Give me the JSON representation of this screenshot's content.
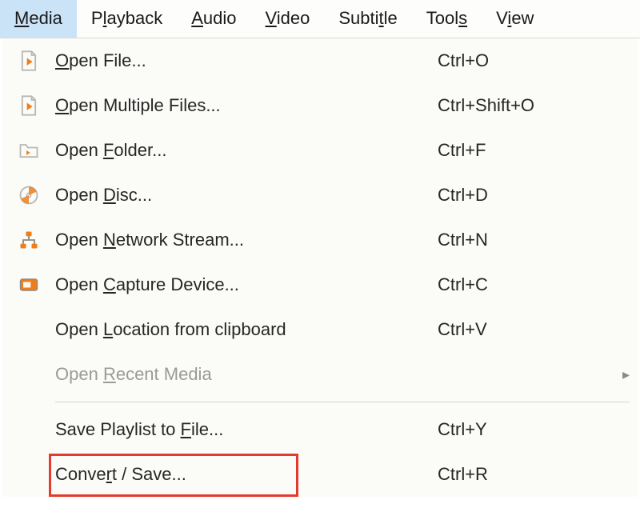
{
  "menubar": {
    "items": [
      {
        "pre": "",
        "u": "M",
        "post": "edia",
        "active": true
      },
      {
        "pre": "P",
        "u": "l",
        "post": "ayback",
        "active": false
      },
      {
        "pre": "",
        "u": "A",
        "post": "udio",
        "active": false
      },
      {
        "pre": "",
        "u": "V",
        "post": "ideo",
        "active": false
      },
      {
        "pre": "Subti",
        "u": "t",
        "post": "le",
        "active": false
      },
      {
        "pre": "Tool",
        "u": "s",
        "post": "",
        "active": false
      },
      {
        "pre": "V",
        "u": "i",
        "post": "ew",
        "active": false
      }
    ]
  },
  "menu": {
    "items": [
      {
        "icon": "file-play",
        "pre": "",
        "u": "O",
        "post": "pen File...",
        "shortcut": "Ctrl+O",
        "disabled": false,
        "submenu": false
      },
      {
        "icon": "file-play",
        "pre": "",
        "u": "O",
        "post": "pen Multiple Files...",
        "shortcut": "Ctrl+Shift+O",
        "disabled": false,
        "submenu": false
      },
      {
        "icon": "folder",
        "pre": "Open ",
        "u": "F",
        "post": "older...",
        "shortcut": "Ctrl+F",
        "disabled": false,
        "submenu": false
      },
      {
        "icon": "disc",
        "pre": "Open ",
        "u": "D",
        "post": "isc...",
        "shortcut": "Ctrl+D",
        "disabled": false,
        "submenu": false
      },
      {
        "icon": "network",
        "pre": "Open ",
        "u": "N",
        "post": "etwork Stream...",
        "shortcut": "Ctrl+N",
        "disabled": false,
        "submenu": false
      },
      {
        "icon": "capture",
        "pre": "Open ",
        "u": "C",
        "post": "apture Device...",
        "shortcut": "Ctrl+C",
        "disabled": false,
        "submenu": false
      },
      {
        "icon": "",
        "pre": "Open ",
        "u": "L",
        "post": "ocation from clipboard",
        "shortcut": "Ctrl+V",
        "disabled": false,
        "submenu": false
      },
      {
        "icon": "",
        "pre": "Open ",
        "u": "R",
        "post": "ecent Media",
        "shortcut": "",
        "disabled": true,
        "submenu": true
      },
      {
        "separator": true
      },
      {
        "icon": "",
        "pre": "Save Playlist to ",
        "u": "F",
        "post": "ile...",
        "shortcut": "Ctrl+Y",
        "disabled": false,
        "submenu": false
      },
      {
        "icon": "",
        "pre": "Conve",
        "u": "r",
        "post": "t / Save...",
        "shortcut": "Ctrl+R",
        "disabled": false,
        "submenu": false,
        "highlight": true
      }
    ]
  },
  "colors": {
    "accent": "#ef7d1a",
    "highlight_border": "#e43b2f",
    "menubar_active": "#cbe3f7"
  }
}
